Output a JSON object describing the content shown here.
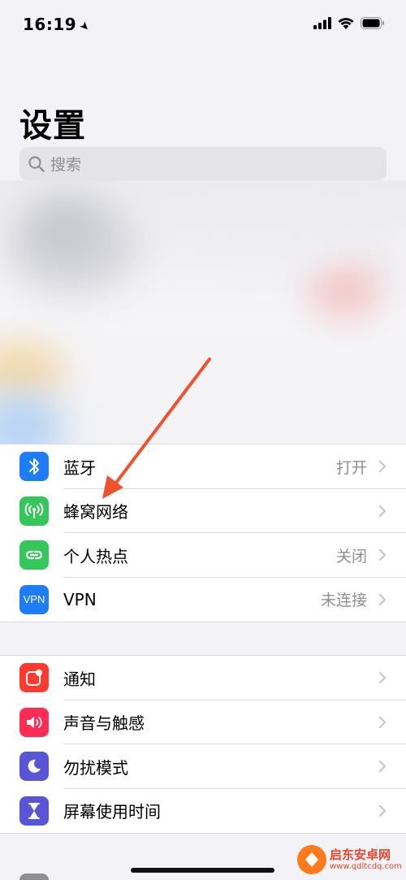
{
  "status_bar": {
    "time": "16:19",
    "location_glyph": "➤"
  },
  "page": {
    "title": "设置"
  },
  "search": {
    "placeholder": "搜索"
  },
  "group_connectivity": [
    {
      "label": "蓝牙",
      "value": "打开",
      "icon": "bluetooth-icon",
      "color": "#1e7cf6"
    },
    {
      "label": "蜂窝网络",
      "value": "",
      "icon": "cellular-antenna-icon",
      "color": "#34c759"
    },
    {
      "label": "个人热点",
      "value": "关闭",
      "icon": "hotspot-link-icon",
      "color": "#34c759"
    },
    {
      "label": "VPN",
      "value": "未连接",
      "icon": "vpn-icon",
      "icon_text": "VPN",
      "color": "#1e7cf6"
    }
  ],
  "group_notifications": [
    {
      "label": "通知",
      "icon": "notifications-icon",
      "color": "#ff3b30"
    },
    {
      "label": "声音与触感",
      "icon": "speaker-icon",
      "color": "#ff2d55"
    },
    {
      "label": "勿扰模式",
      "icon": "moon-icon",
      "color": "#5856d6"
    },
    {
      "label": "屏幕使用时间",
      "icon": "hourglass-icon",
      "color": "#5856d6"
    }
  ],
  "watermark": {
    "title": "启东安卓网",
    "url": "www.qdltcdq.com"
  }
}
